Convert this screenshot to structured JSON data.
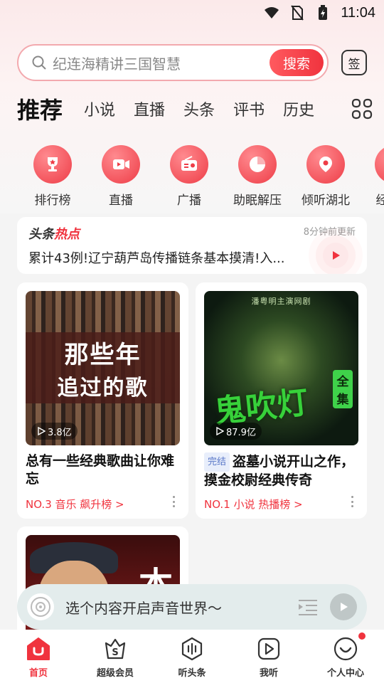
{
  "status_bar": {
    "time": "11:04"
  },
  "search": {
    "placeholder": "纪连海精讲三国智慧",
    "button_label": "搜索",
    "sign_label": "签"
  },
  "tabs": [
    {
      "label": "推荐"
    },
    {
      "label": "小说"
    },
    {
      "label": "直播"
    },
    {
      "label": "头条"
    },
    {
      "label": "评书"
    },
    {
      "label": "历史"
    }
  ],
  "quick_links": [
    {
      "label": "排行榜",
      "icon": "trophy-icon"
    },
    {
      "label": "直播",
      "icon": "video-icon"
    },
    {
      "label": "广播",
      "icon": "radio-icon"
    },
    {
      "label": "助眠解压",
      "icon": "moon-icon"
    },
    {
      "label": "倾听湖北",
      "icon": "location-icon"
    },
    {
      "label": "经典必",
      "icon": "flame-icon"
    }
  ],
  "headline": {
    "brand_part1": "头条",
    "brand_part2": "热点",
    "updated": "8分钟前更新",
    "text": "累计43例!辽宁葫芦岛传播链条基本摸清!入..."
  },
  "cards": [
    {
      "cover_line1": "那些年",
      "cover_line2": "追过的歌",
      "plays": "3.8亿",
      "title": "总有一些经典歌曲让你难忘",
      "rank": "NO.3 音乐 飙升榜 >"
    },
    {
      "cover_top": "潘粤明主演网剧",
      "cover_title": "鬼吹灯",
      "cover_seal_1": "全",
      "cover_seal_2": "集",
      "plays": "87.9亿",
      "tag": "完结",
      "title": "盗墓小说开山之作，摸金校尉经典传奇",
      "rank": "NO.1 小说 热播榜 >"
    },
    {
      "cover_title": "本"
    }
  ],
  "player": {
    "text": "选个内容开启声音世界～"
  },
  "bottom_nav": [
    {
      "label": "首页",
      "active": true
    },
    {
      "label": "超级会员"
    },
    {
      "label": "听头条"
    },
    {
      "label": "我听"
    },
    {
      "label": "个人中心"
    }
  ],
  "colors": {
    "accent": "#f0333e",
    "player_bg": "#e3ecec"
  }
}
